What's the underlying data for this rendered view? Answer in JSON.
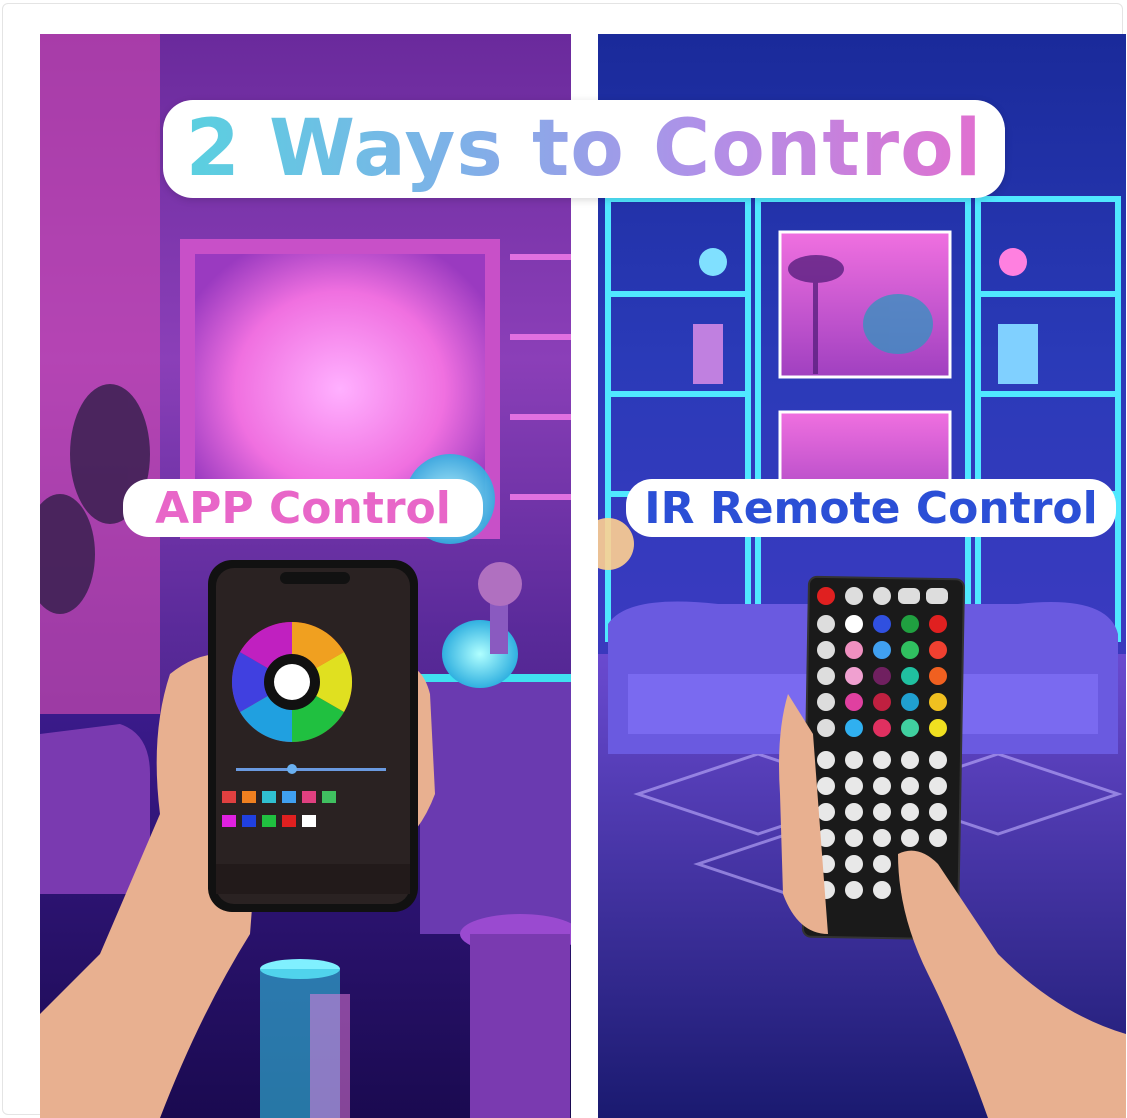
{
  "title": "2 Ways to Control",
  "labels": {
    "app": "APP Control",
    "ir": "IR Remote Control"
  },
  "colors": {
    "title_gradient": [
      "#5ad0e0",
      "#e070d0"
    ],
    "app_label": "#e866c8",
    "ir_label": "#2b4fd6"
  }
}
